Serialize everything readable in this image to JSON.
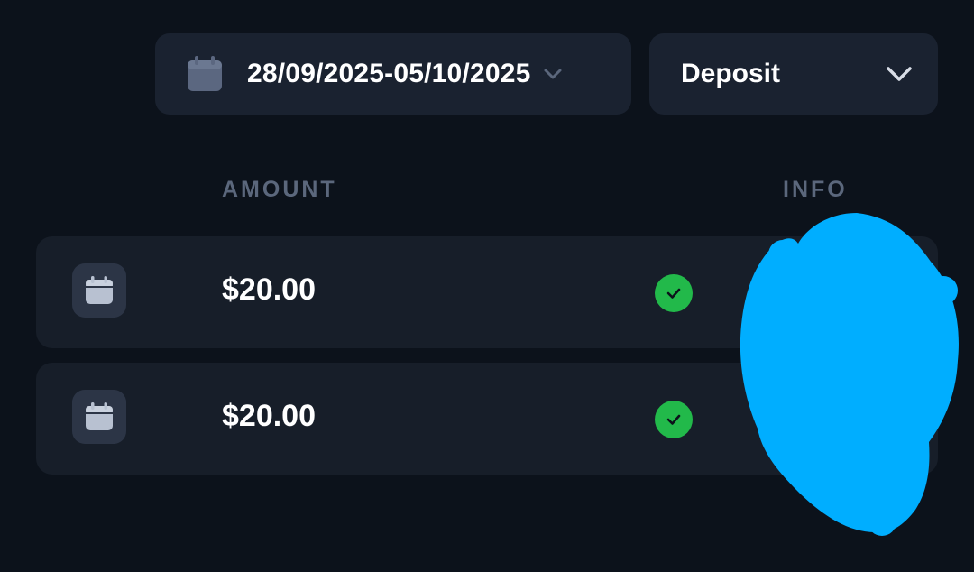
{
  "filters": {
    "date_range": "28/09/2025-05/10/2025",
    "date_icon": "calendar-icon",
    "type_value": "Deposit",
    "type_icon": "chevron-down-icon"
  },
  "table": {
    "columns": [
      "AMOUNT",
      "INFO"
    ],
    "rows": [
      {
        "icon": "calendar-icon",
        "amount": "$20.00",
        "status": "success"
      },
      {
        "icon": "calendar-icon",
        "amount": "$20.00",
        "status": "success"
      }
    ]
  },
  "colors": {
    "background": "#0c121b",
    "card": "#1a2230",
    "row": "#171e29",
    "header_text": "#5b677c",
    "success": "#22b94a",
    "redaction": "#00aeff"
  }
}
